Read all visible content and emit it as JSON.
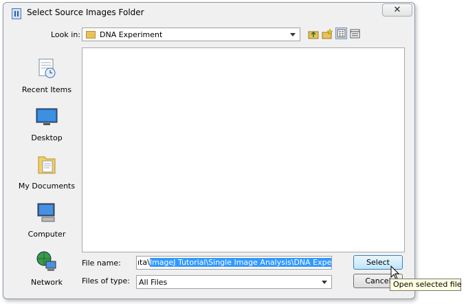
{
  "window": {
    "title": "Select Source Images Folder",
    "close_label": "✕"
  },
  "look_in": {
    "label": "Look in:",
    "value": "DNA Experiment"
  },
  "toolbar": {
    "buttons": [
      {
        "icon": "up-one-level-icon"
      },
      {
        "icon": "new-folder-icon"
      },
      {
        "icon": "list-view-icon"
      },
      {
        "icon": "details-view-icon"
      }
    ]
  },
  "places": [
    {
      "label": "Recent Items",
      "icon": "recent-items-icon"
    },
    {
      "label": "Desktop",
      "icon": "desktop-icon"
    },
    {
      "label": "My Documents",
      "icon": "my-documents-icon"
    },
    {
      "label": "Computer",
      "icon": "computer-icon"
    },
    {
      "label": "Network",
      "icon": "network-icon"
    }
  ],
  "file_name": {
    "label": "File name:",
    "prefix": "ıta\\",
    "selected": "ImageJ Tutorial\\Single Image Analysis\\DNA Experiment"
  },
  "files_of_type": {
    "label": "Files of type:",
    "value": "All Files"
  },
  "buttons": {
    "select": "Select",
    "cancel": "Cancel"
  },
  "tooltip": "Open selected file",
  "colors": {
    "selection": "#3399ff",
    "default_button": "#bee6fd"
  }
}
